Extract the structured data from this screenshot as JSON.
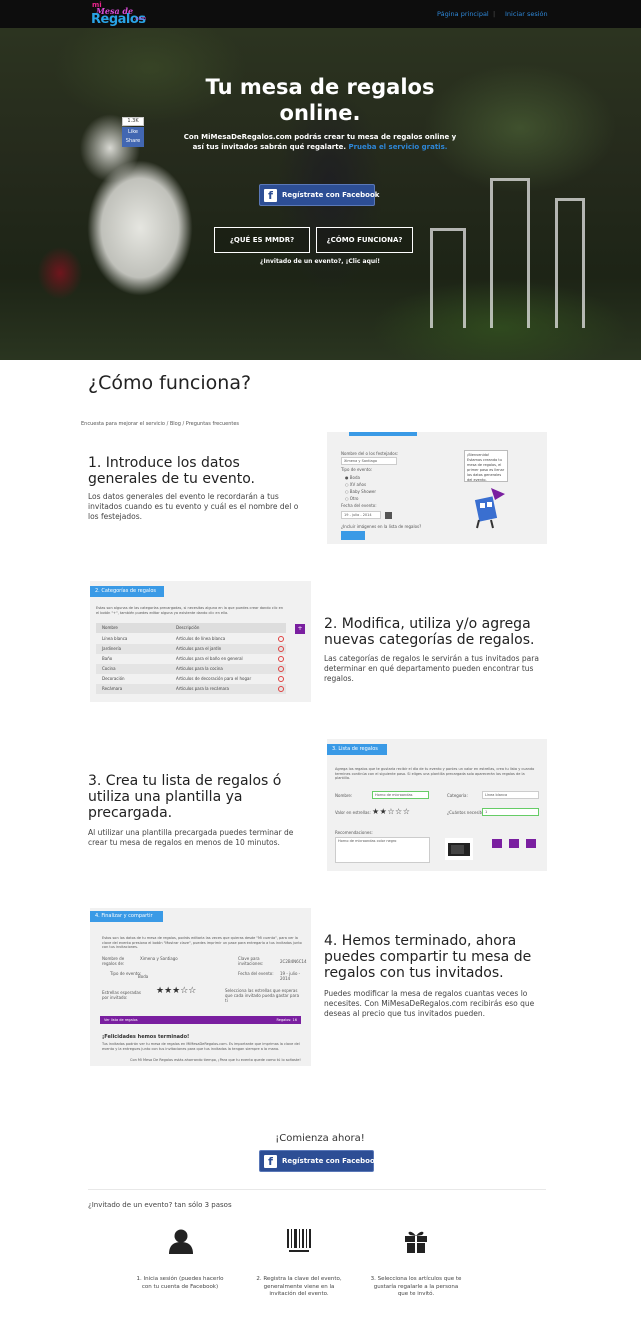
{
  "nav": {
    "logo": {
      "line1": "mi",
      "line2": "Mesa de",
      "line3": "Regalos",
      "line4": ".com"
    },
    "home_label": "Página principal",
    "separator": "|",
    "login_label": "Iniciar sesión"
  },
  "hero": {
    "title_line1": "Tu mesa de regalos",
    "title_line2": "online.",
    "subtitle_line1": "Con MiMesaDeRegalos.com podrás crear tu mesa de regalos online y",
    "subtitle_line2": "así tus invitados sabrán qué regalarte.",
    "subtitle_link": "Prueba el servicio gratis.",
    "fb_like": {
      "count": "1.3K",
      "like_label": "Like",
      "share_label": "Share"
    },
    "facebook_button": "Regístrate con Facebook",
    "what_button": "¿QUÉ ES MMDR?",
    "how_button": "¿CÓMO FUNCIONA?",
    "guest_link": "¿Invitado de un evento?, ¡Clic aquí!"
  },
  "how": {
    "title": "¿Cómo funciona?",
    "breadcrumbs": "Encuesta para mejorar el servicio / Blog / Preguntas frecuentes",
    "steps": [
      {
        "title_lines": [
          "1. Introduce los datos",
          "generales de tu evento."
        ],
        "desc_lines": [
          "Los datos generales del evento le recordarán a tus",
          "invitados cuando es tu evento y cuál es el nombre del o",
          "los festejados."
        ]
      },
      {
        "title_lines": [
          "2. Modifica, utiliza y/o agrega",
          "nuevas categorías de regalos."
        ],
        "desc_lines": [
          "Las categorías de regalos le servirán a tus invitados para",
          "determinar en qué departamento pueden encontrar tus",
          "regalos."
        ]
      },
      {
        "title_lines": [
          "3. Crea tu lista de regalos ó",
          "utiliza una plantilla ya",
          "precargada."
        ],
        "desc_lines": [
          "Al utilizar una plantilla precargada puedes terminar de",
          "crear tu mesa de regalos en menos de 10 minutos."
        ]
      },
      {
        "title_lines": [
          "4. Hemos terminado, ahora",
          "puedes compartir tu mesa de",
          "regalos con tus invitados."
        ],
        "desc_lines": [
          "Puedes modificar la mesa de regalos cuantas veces lo",
          "necesites. Con MiMesaDeRegalos.com recibirás eso que",
          "deseas al precio que tus invitados pueden."
        ]
      }
    ]
  },
  "shot1": {
    "name_label": "Nombre del o los festejados:",
    "name_value": "Ximena y Santiago",
    "type_label": "Tipo de evento:",
    "options": [
      "Boda",
      "XV años",
      "Baby Shower",
      "Otro"
    ],
    "date_label": "Fecha del evento:",
    "date_value": "19 - julio - 2014",
    "images_label": "¿Incluir imágenes en la lista de regalos?",
    "bubble": "¡Bienvenido! Estamos creando tu mesa de regalos, el primer paso es llenar los datos generales del evento."
  },
  "shot2": {
    "header": "2. Categorías de regalos",
    "intro": "Estas son algunas de las categorías precargadas, si necesitas alguna en la que puedes crear dando clic en el botón \"+\", también puedes editar alguna ya existente dando clic en ella.",
    "col1": "Nombre",
    "col2": "Descripción",
    "rows": [
      {
        "name": "Línea blanca",
        "desc": "Artículos de línea blanca"
      },
      {
        "name": "Jardinería",
        "desc": "Artículos para el jardín"
      },
      {
        "name": "Baño",
        "desc": "Artículos para el baño en general"
      },
      {
        "name": "Cocina",
        "desc": "Artículos para la cocina"
      },
      {
        "name": "Decoración",
        "desc": "Artículos de decoración para el hogar"
      },
      {
        "name": "Recámara",
        "desc": "Artículos para la recámara"
      }
    ],
    "add_label": "+"
  },
  "shot3": {
    "header": "3. Lista de regalos",
    "intro": "Agrega los regalos que te gustaría recibir el día de tu evento y ponles un valor en estrellas, crea tu lista y cuando termines continúa con el siguiente paso. Si eliges una plantilla precargada solo aparecerán los regalos de la plantilla.",
    "name_label": "Nombre:",
    "name_value": "Horno de microondas",
    "category_label": "Categoría:",
    "category_value": "Línea blanca",
    "stars_label": "Valor en estrellas:",
    "qty_label": "¿Cuántos necesito?",
    "qty_value": "1",
    "rec_label": "Recomendaciones:",
    "rec_value": "Horno de microondas color negro",
    "rating": 2,
    "rating_max": 5
  },
  "shot4": {
    "header": "4. Finalizar y compartir",
    "intro": "Estos son los datos de tu mesa de regalos, podrás editarla las veces que quieras desde \"Mi cuenta\", para ver la clave del evento presiona el botón \"Mostrar clave\", puedes imprimir un pase para entregarlo a tus invitados junto con tus invitaciones.",
    "name_label": "Nombre de regalos de:",
    "name_value": "Ximena y Santiago",
    "key_label": "Clave para invitaciones:",
    "key_value": "2C2B4N6C14",
    "type_label": "Tipo de evento:",
    "type_value": "Boda",
    "date_label": "Fecha del evento:",
    "date_value": "19 - julio - 2014",
    "stars_label": "Estrellas esperadas por invitado:",
    "stars_note": "Selecciona las estrellas que esperas que cada invitado pueda gastar para ti",
    "rating": 3,
    "rating_max": 5,
    "bar_left": "Ver lista de regalos",
    "bar_right": "Regalos: 16",
    "congrats": "¡Felicidades hemos terminado!",
    "final_text": "Tus invitados podrán ver tu mesa de regalos en MiMesaDeRegalos.com. Es importante que imprimas la clave del evento y la entregues junto con tus invitaciones para que tus invitados la tengan siempre a la mano.",
    "final_text2": "Con Mi Mesa De Regalos estás ahorrando tiempo, ¡Para que tu evento quede como tú lo soñaste!"
  },
  "bottom": {
    "start_title": "¡Comienza ahora!",
    "facebook_button": "Regístrate con Facebook",
    "guest_title": "¿Invitado de un evento? tan sólo 3 pasos",
    "steps": [
      {
        "icon": "user-icon",
        "lines": [
          "1. Inicia sesión (puedes hacerlo",
          "con tu cuenta de Facebook)"
        ]
      },
      {
        "icon": "barcode-icon",
        "lines": [
          "2. Registra la clave del evento,",
          "generalmente viene en la",
          "invitación del evento."
        ]
      },
      {
        "icon": "gift-icon",
        "lines": [
          "3. Selecciona los artículos que te",
          "gustaría regalarle a la persona",
          "que te invitó."
        ]
      }
    ]
  },
  "colors": {
    "accent_blue": "#2e86d6",
    "facebook_blue": "#2d4e95",
    "screenshot_header": "#3a9ae6",
    "purple": "#7a1fa0"
  }
}
